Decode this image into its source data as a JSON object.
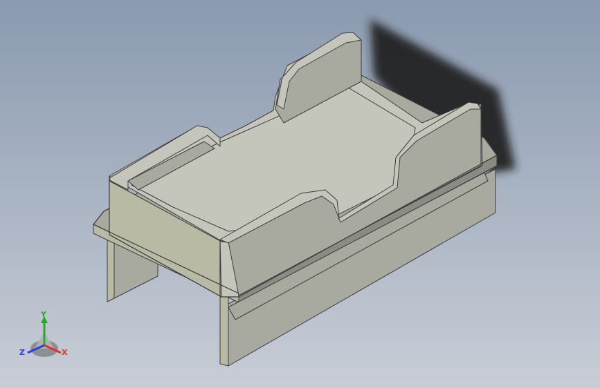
{
  "viewport": {
    "background_top": "#8a9ab0",
    "background_bottom": "#c8cdd6"
  },
  "triad": {
    "x_label": "X",
    "y_label": "Y",
    "z_label": "Z",
    "x_color": "#e03030",
    "y_color": "#2aa82a",
    "z_color": "#2840e0"
  },
  "model": {
    "face_light": "#c4c6bc",
    "face_mid": "#a8aaa0",
    "face_dark": "#8a8c84",
    "face_front": "#b8baa4",
    "edge_color": "#3a3a3a",
    "shadow_color": "#1e1e1e"
  }
}
